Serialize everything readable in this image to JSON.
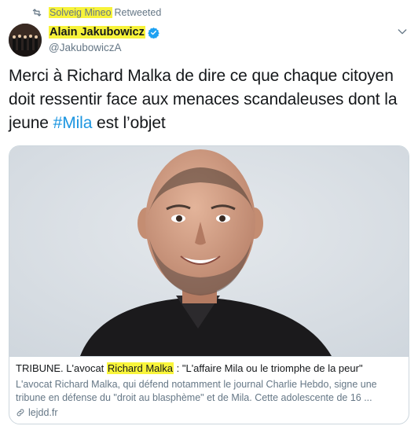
{
  "retweet": {
    "retweeter": "Solveig Mineo",
    "suffix": "Retweeted"
  },
  "author": {
    "name": "Alain Jakubowicz",
    "handle": "@JakubowiczA"
  },
  "tweet": {
    "text_before": "Merci à Richard Malka de dire ce que chaque citoyen doit ressentir face aux menaces scandaleuses dont la jeune ",
    "hashtag": "#Mila",
    "text_after": " est l’objet"
  },
  "card": {
    "title_prefix": "TRIBUNE. L'avocat ",
    "title_highlight": "Richard Malka",
    "title_suffix": " : \"L'affaire Mila ou le triomphe de la peur\"",
    "description": "L'avocat Richard Malka, qui défend notamment le journal Charlie Hebdo, signe une tribune en défense du \"droit au blasphème\" et de Mila. Cette adolescente de 16 ...",
    "domain": "lejdd.fr"
  },
  "colors": {
    "highlight": "#f7f33a",
    "hashtag": "#1b95e0",
    "verified": "#1da1f2",
    "secondary_text": "#657786"
  },
  "icons": {
    "retweet": "retweet-icon",
    "verified": "verified-badge-icon",
    "menu": "chevron-down-icon",
    "link": "link-icon"
  }
}
